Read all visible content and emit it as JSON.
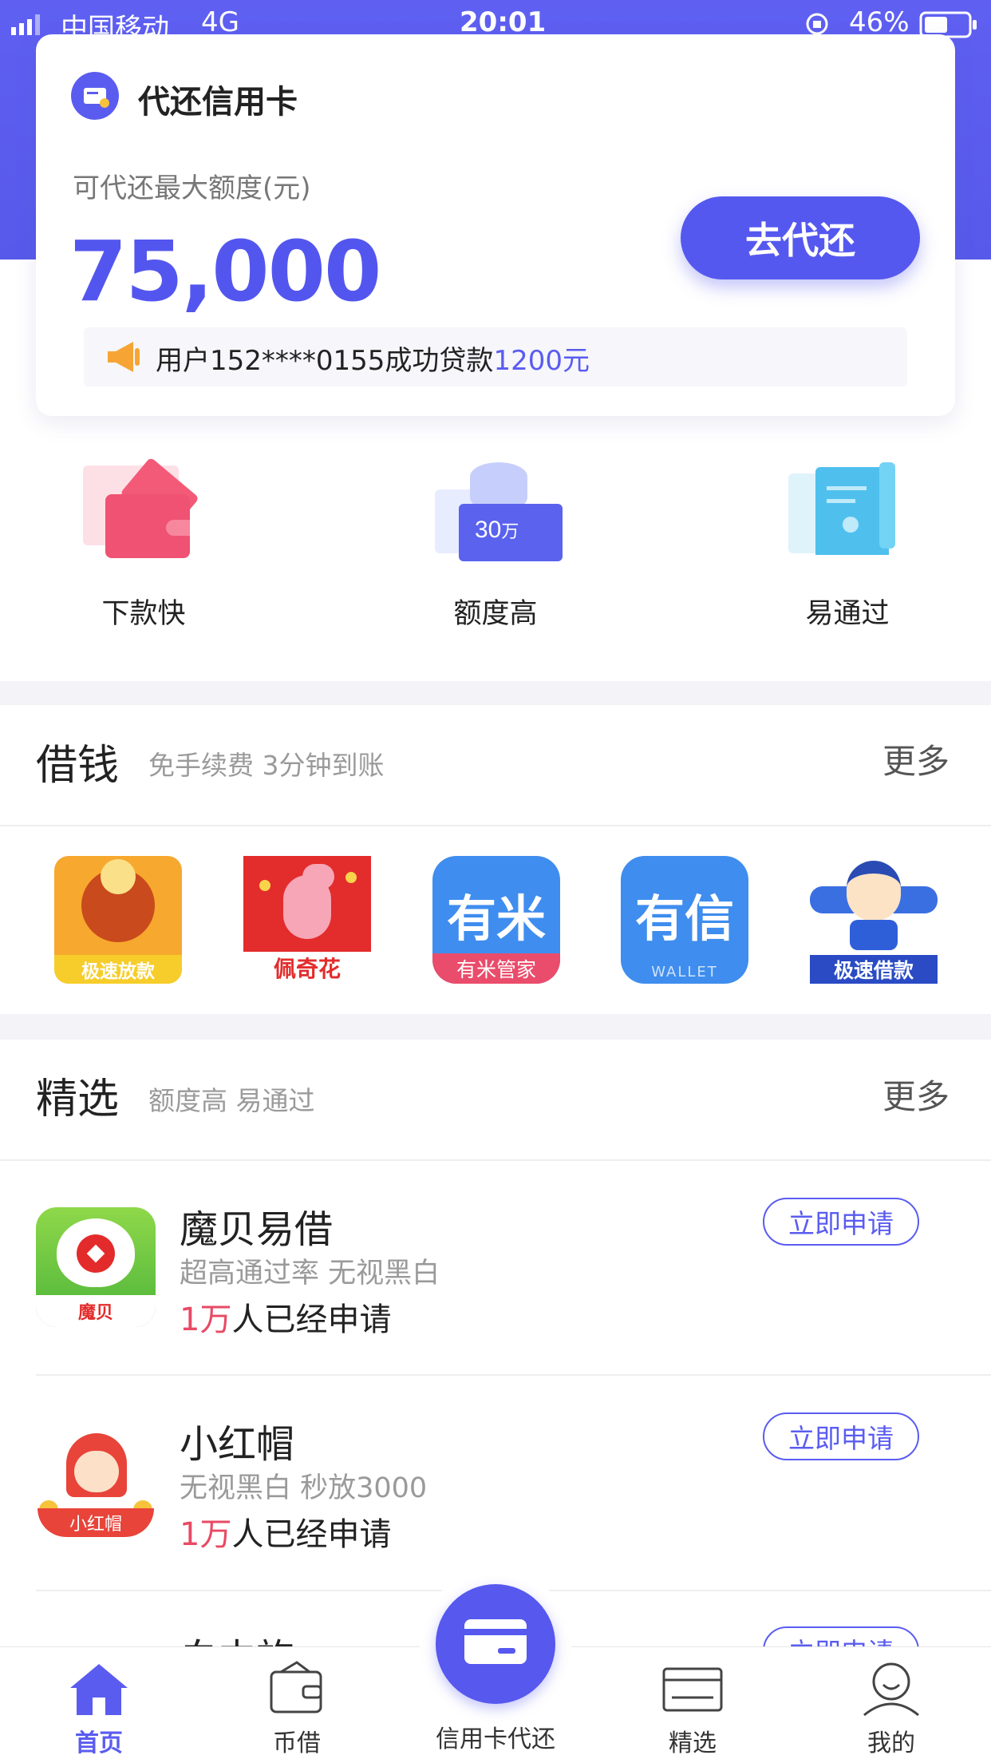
{
  "status_bar": {
    "carrier": "中国移动",
    "network": "4G",
    "time": "20:01",
    "battery": "46%"
  },
  "card": {
    "title": "代还信用卡",
    "limit_label": "可代还最大额度(元)",
    "limit_value": "75,000",
    "button_label": "去代还",
    "notice_prefix": "用户152****0155成功贷款",
    "notice_amount": "1200元"
  },
  "features": [
    {
      "label": "下款快",
      "icon": "wallet-icon"
    },
    {
      "label": "额度高",
      "icon": "coin-stack-icon",
      "badge": "30",
      "badge_unit": "万"
    },
    {
      "label": "易通过",
      "icon": "receipt-icon"
    }
  ],
  "borrow_section": {
    "title": "借钱",
    "subtitle": "免手续费 3分钟到账",
    "more": "更多",
    "apps": [
      {
        "label": "极速放款",
        "icon": "cartoon-ox-icon",
        "color": "#f5a623"
      },
      {
        "label": "佩奇花",
        "icon": "peppa-pig-icon",
        "color": "#e32c2c"
      },
      {
        "label": "有米管家",
        "logo": "有米",
        "icon": "youmi-logo-icon",
        "color": "#3f8dee"
      },
      {
        "label": "WALLET",
        "logo": "有信",
        "icon": "youxin-logo-icon",
        "color": "#3f8dee"
      },
      {
        "label": "极速借款",
        "icon": "cartoon-hero-icon",
        "color": "#2f5fd8"
      }
    ]
  },
  "featured_section": {
    "title": "精选",
    "subtitle": "额度高 易通过",
    "more": "更多",
    "products": [
      {
        "name": "魔贝易借",
        "desc": "超高通过率 无视黑白",
        "count": "1万",
        "count_suffix": "人已经申请",
        "apply": "立即申请",
        "logo_text": "魔贝",
        "icon": "shell-logo-icon"
      },
      {
        "name": "小红帽",
        "desc": "无视黑白 秒放3000",
        "count": "1万",
        "count_suffix": "人已经申请",
        "apply": "立即申请",
        "logo_text": "小红帽",
        "icon": "red-hood-girl-icon"
      },
      {
        "name": "白中旅",
        "apply": "立即申请"
      }
    ]
  },
  "tabbar": {
    "tabs": [
      {
        "label": "首页",
        "icon": "home-icon",
        "active": true
      },
      {
        "label": "币借",
        "icon": "wallet-icon",
        "active": false
      },
      {
        "label": "信用卡代还",
        "icon": "credit-card-icon",
        "active": false
      },
      {
        "label": "精选",
        "icon": "card-list-icon",
        "active": false
      },
      {
        "label": "我的",
        "icon": "user-icon",
        "active": false
      }
    ]
  },
  "colors": {
    "accent": "#5a5cf0",
    "highlight": "#e84a64",
    "separator": "#f3f3f8"
  }
}
